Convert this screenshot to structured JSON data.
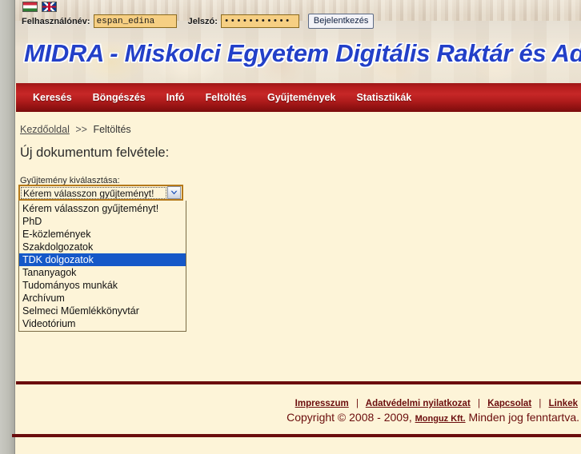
{
  "login": {
    "flag_hu_name": "hungarian-flag-icon",
    "flag_uk_name": "english-flag-icon",
    "username_label": "Felhasználónév:",
    "username_value": "espan_edina",
    "username_placeholder": "",
    "password_label": "Jelszó:",
    "password_value": "•••••••••••",
    "password_placeholder": "",
    "submit_label": "Bejelentkezés"
  },
  "banner": {
    "title": "MIDRA - Miskolci Egyetem Digitális Raktár és Adattár"
  },
  "nav": {
    "items": [
      {
        "label": "Keresés"
      },
      {
        "label": "Böngészés"
      },
      {
        "label": "Infó"
      },
      {
        "label": "Feltöltés"
      },
      {
        "label": "Gyűjtemények"
      },
      {
        "label": "Statisztikák"
      }
    ]
  },
  "breadcrumb": {
    "home": "Kezdőoldal",
    "separator": ">>",
    "current": "Feltöltés"
  },
  "main": {
    "page_title": "Új dokumentum felvétele:",
    "select_label": "Gyűjtemény kiválasztása:",
    "selected_value": "Kérem válasszon gyűjteményt!",
    "highlighted_option": "TDK dolgozatok",
    "options": [
      "Kérem válasszon gyűjteményt!",
      "PhD",
      "E-közlemények",
      "Szakdolgozatok",
      "TDK dolgozatok",
      "Tananyagok",
      "Tudományos munkák",
      "Archívum",
      "Selmeci Műemlékkönyvtár",
      "Videotórium"
    ],
    "highlight_color": "#1558c8"
  },
  "footer": {
    "links": [
      {
        "label": "Impresszum"
      },
      {
        "label": "Adatvédelmi nyilatkozat"
      },
      {
        "label": "Kapcsolat"
      },
      {
        "label": "Linkek"
      }
    ],
    "separator": "|",
    "copyright_prefix": "Copyright © 2008 - 2009,",
    "company": "Monguz Kft.",
    "copyright_suffix": "Minden jog fenntartva.",
    "rule_color": "#6b0d0d"
  }
}
